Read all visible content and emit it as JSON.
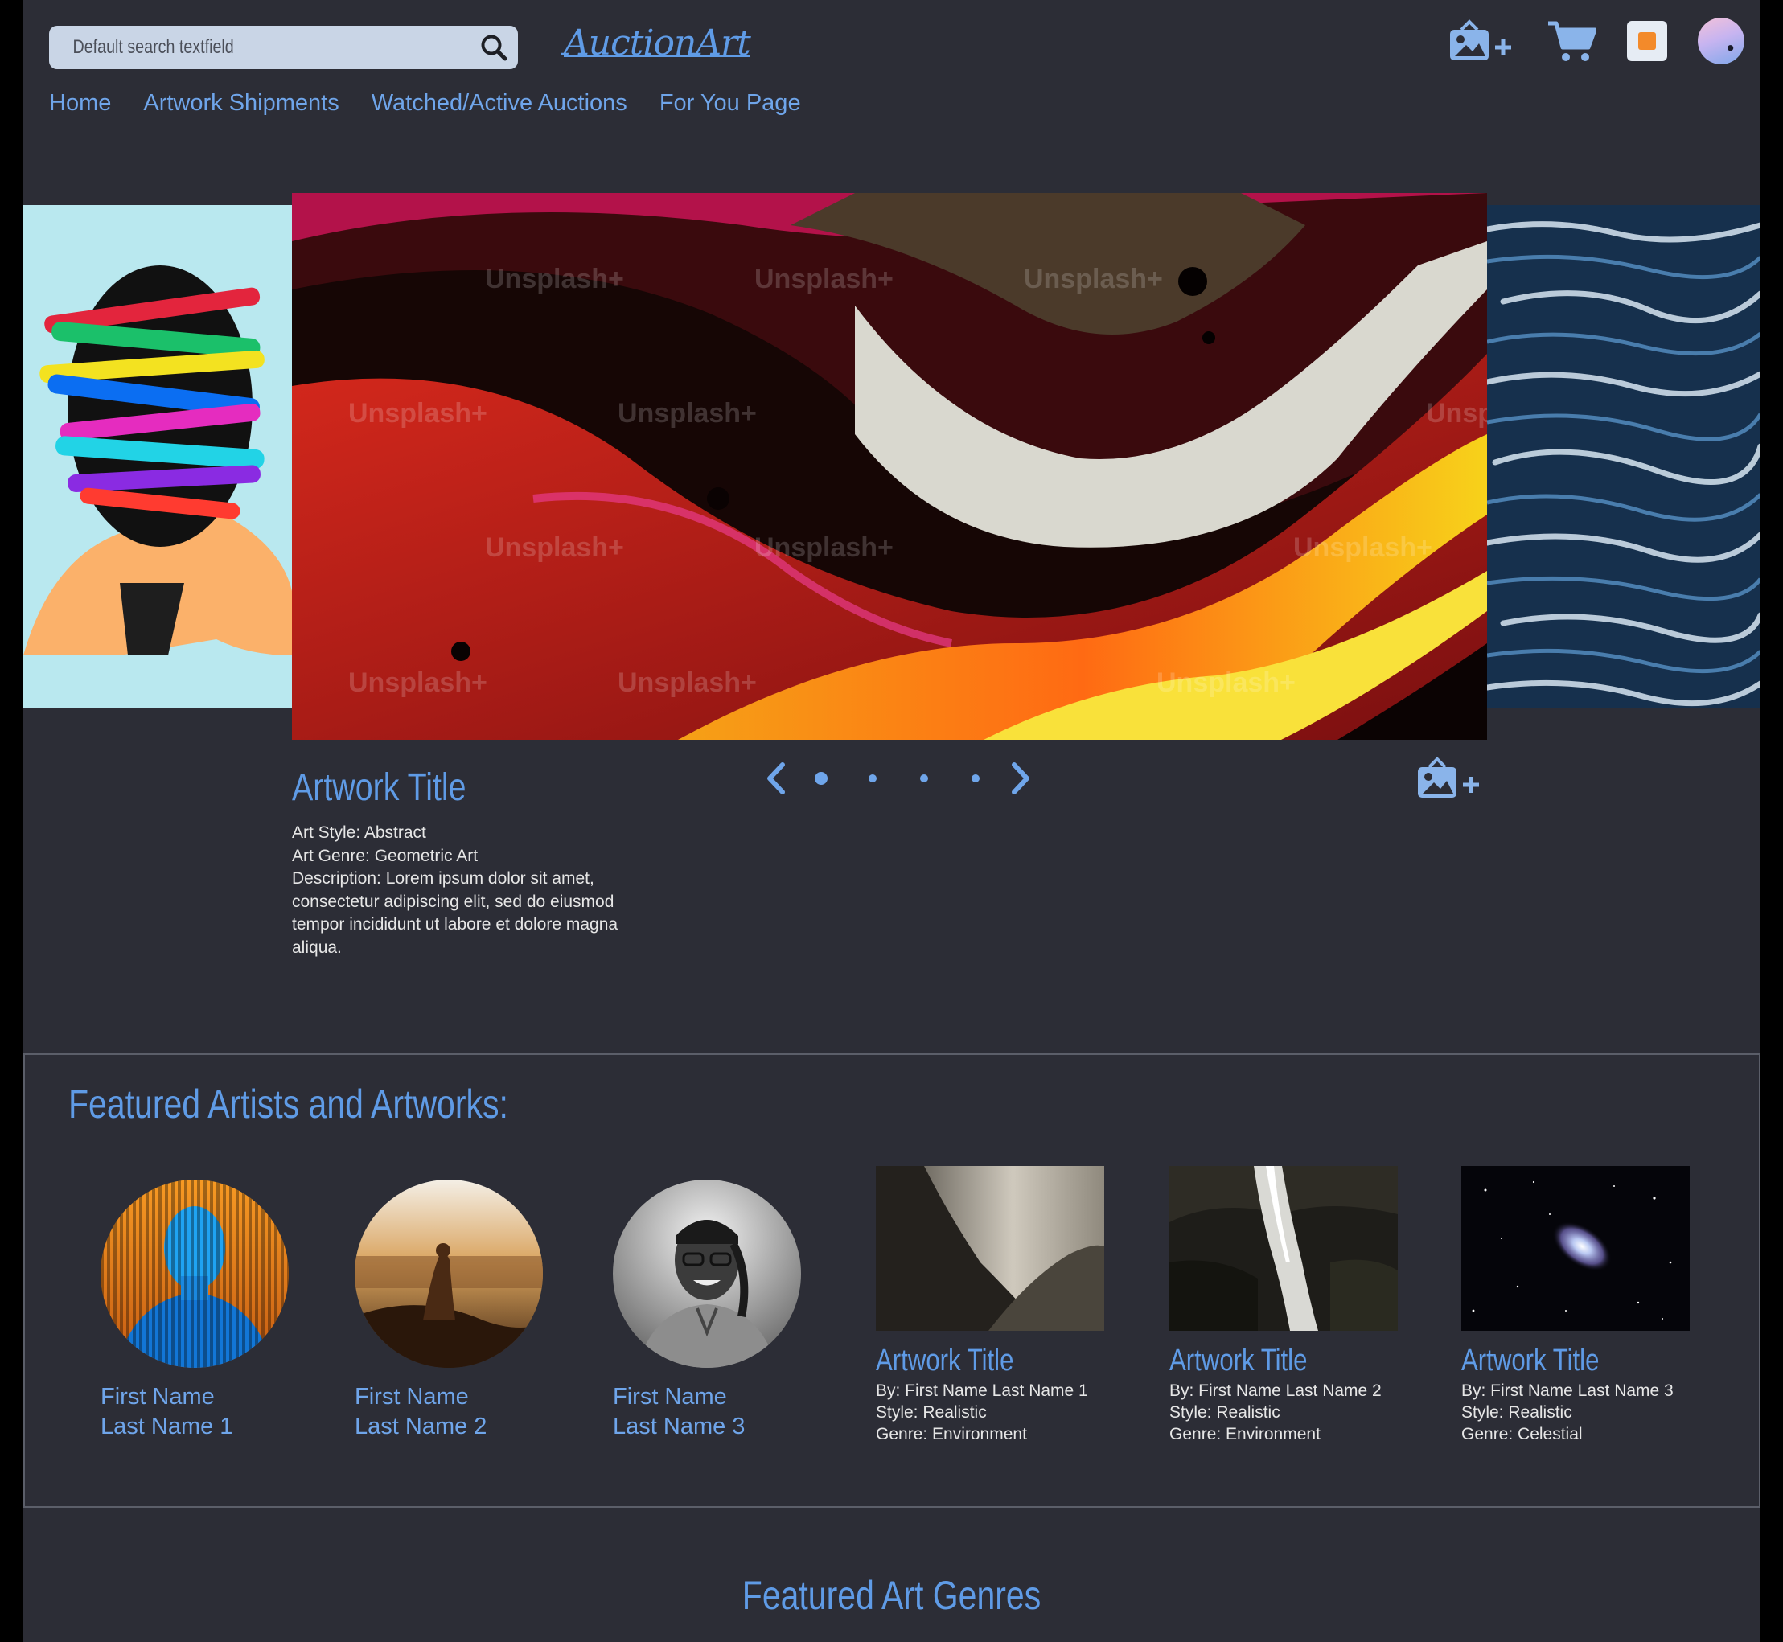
{
  "header": {
    "search_placeholder": "Default search textfield",
    "logo": "AuctionArt",
    "icons": [
      "add-artwork-icon",
      "cart-icon",
      "stop-icon",
      "profile-avatar"
    ]
  },
  "nav": {
    "items": [
      "Home",
      "Artwork Shipments",
      "Watched/Active Auctions",
      "For You Page"
    ]
  },
  "carousel": {
    "watermark": "Unsplash+",
    "title": "Artwork Title",
    "style": "Art Style: Abstract",
    "genre": "Art Genre: Geometric Art",
    "description": "Description: Lorem ipsum dolor sit amet, consectetur adipiscing elit, sed do eiusmod tempor incididunt ut labore et dolore magna aliqua.",
    "dots": 4,
    "active_dot": 0
  },
  "featured": {
    "heading": "Featured Artists and Artworks:",
    "artists": [
      {
        "first": "First Name",
        "last": "Last Name 1"
      },
      {
        "first": "First Name",
        "last": "Last Name 2"
      },
      {
        "first": "First Name",
        "last": "Last Name 3"
      }
    ],
    "artworks": [
      {
        "title": "Artwork Title",
        "by": "By: First Name Last Name 1",
        "style": "Style: Realistic",
        "genre": "Genre: Environment"
      },
      {
        "title": "Artwork Title",
        "by": "By: First Name Last Name 2",
        "style": "Style: Realistic",
        "genre": "Genre: Environment"
      },
      {
        "title": "Artwork Title",
        "by": "By: First Name Last Name 3",
        "style": "Style: Realistic",
        "genre": "Genre: Celestial"
      }
    ]
  },
  "genres": {
    "heading": "Featured Art Genres"
  },
  "colors": {
    "background": "#2c2d36",
    "accent": "#5f9be6",
    "text": "#e6e6e6"
  }
}
